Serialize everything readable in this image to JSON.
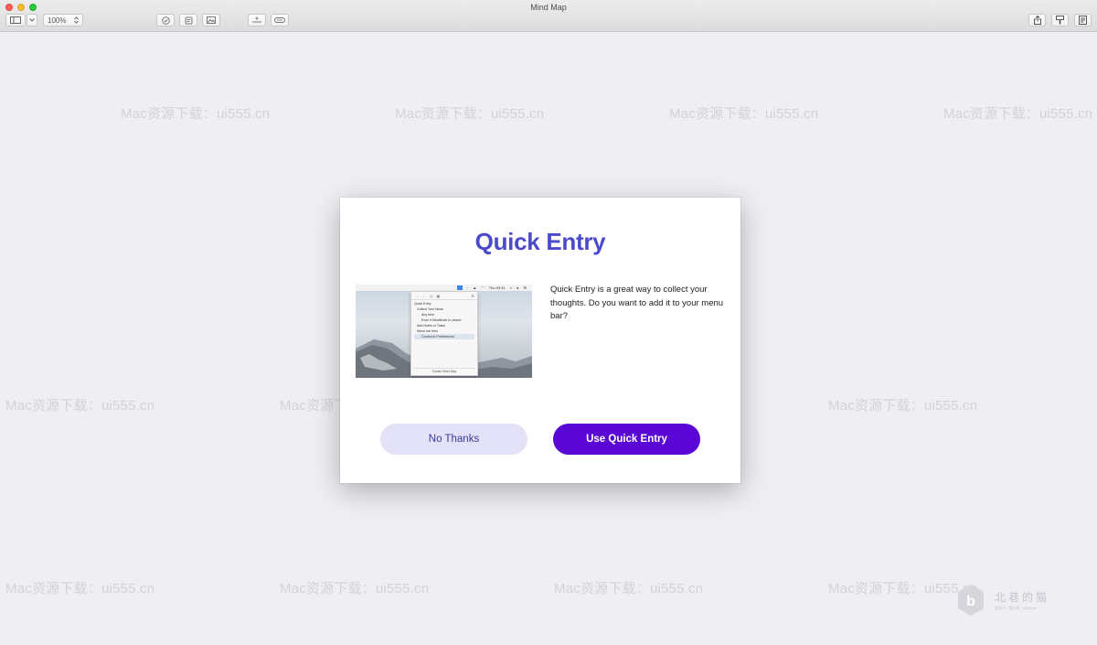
{
  "window": {
    "title": "Mind Map"
  },
  "toolbar": {
    "zoom_value": "100%"
  },
  "dialog": {
    "title": "Quick Entry",
    "description": "Quick Entry is a great way to collect your thoughts. Do you want to add it to your menu bar?",
    "secondary_button": "No Thanks",
    "primary_button": "Use Quick Entry",
    "accent_color": "#4b4acc",
    "primary_color": "#5a07d6",
    "preview": {
      "clock": "Thu 09:41",
      "items": [
        "Quick Entry",
        "Collect Your Ideas",
        "Any time",
        "Even if MindNode is closed",
        "Add Notes or Tasks",
        "Menu bar Item",
        "Control in Preferences"
      ],
      "footer": "Create Mind Map"
    }
  },
  "watermarks": {
    "text": "Mac资源下载：ui555.cn",
    "logo_text": "北巷的猫",
    "logo_sub": "爱设计 · 爱分享 · ui555.cn"
  }
}
